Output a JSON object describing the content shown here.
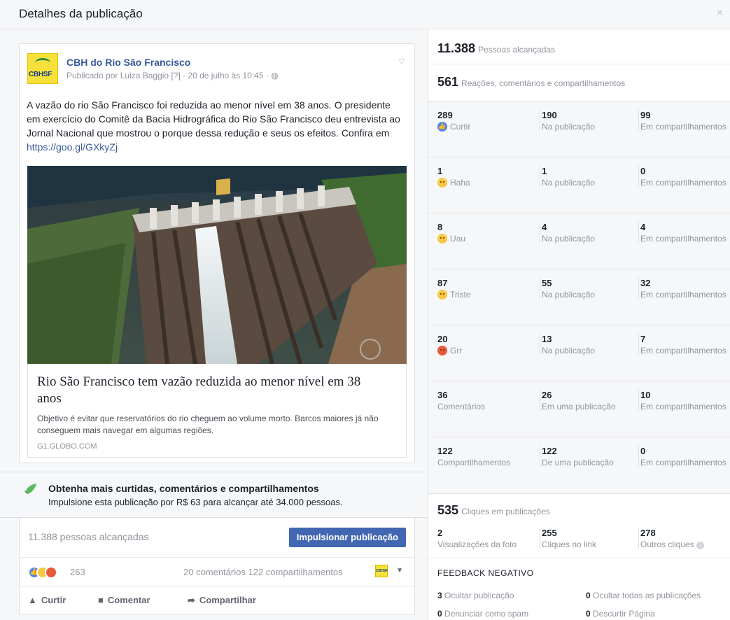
{
  "modal": {
    "title": "Detalhes da publicação",
    "close": "×"
  },
  "post": {
    "page_name": "CBH do Rio São Francisco",
    "logo_text": "CBHSF",
    "meta": "Publicado por Luiza Baggio [?] · 20 de julho às 10:45 · ◍",
    "text": "A vazão do rio São Francisco foi reduzida ao menor nível em 38 anos. O presidente em exercício do Comitê da Bacia Hidrográfica do Rio São Francisco deu entrevista ao Jornal Nacional que mostrou o porque dessa redução e seus os efeitos. Confira em ",
    "link_text": "https://goo.gl/GXkyZj",
    "link_title": "Rio São Francisco tem vazão reduzida ao menor nível em 38 anos",
    "link_desc": "Objetivo é evitar que reservatórios do rio cheguem ao volume morto. Barcos maiores já não conseguem mais navegar em algumas regiões.",
    "link_domain": "G1.GLOBO.COM"
  },
  "boost": {
    "title": "Obtenha mais curtidas, comentários e compartilhamentos",
    "subtitle": "Impulsione esta publicação por R$ 63 para alcançar até 34.000 pessoas.",
    "reach": "11.388 pessoas alcançadas",
    "button": "Impulsionar publicação"
  },
  "reactions_bar": {
    "count": "263",
    "comments_shares": "20 comentários  122 compartilhamentos"
  },
  "actions": {
    "like": "Curtir",
    "comment": "Comentar",
    "share": "Compartilhar"
  },
  "insights": {
    "reach_num": "11.388",
    "reach_lbl": "Pessoas alcançadas",
    "engage_num": "561",
    "engage_lbl": "Reações, comentários e compartilhamentos",
    "rows": [
      {
        "total": "289",
        "label": "Curtir",
        "post": "190",
        "post_lbl": "Na publicação",
        "shares": "99",
        "shares_lbl": "Em compartilhamentos"
      },
      {
        "total": "1",
        "label": "Haha",
        "post": "1",
        "post_lbl": "Na publicação",
        "shares": "0",
        "shares_lbl": "Em compartilhamentos"
      },
      {
        "total": "8",
        "label": "Uau",
        "post": "4",
        "post_lbl": "Na publicação",
        "shares": "4",
        "shares_lbl": "Em compartilhamentos"
      },
      {
        "total": "87",
        "label": "Triste",
        "post": "55",
        "post_lbl": "Na publicação",
        "shares": "32",
        "shares_lbl": "Em compartilhamentos"
      },
      {
        "total": "20",
        "label": "Grr",
        "post": "13",
        "post_lbl": "Na publicação",
        "shares": "7",
        "shares_lbl": "Em compartilhamentos"
      },
      {
        "total": "36",
        "label": "Comentários",
        "post": "26",
        "post_lbl": "Em uma publicação",
        "shares": "10",
        "shares_lbl": "Em compartilhamentos"
      },
      {
        "total": "122",
        "label": "Compartilhamentos",
        "post": "122",
        "post_lbl": "De uma publicação",
        "shares": "0",
        "shares_lbl": "Em compartilhamentos"
      }
    ],
    "clicks_num": "535",
    "clicks_lbl": "Cliques em publicações",
    "clicks": [
      {
        "num": "2",
        "lbl": "Visualizações da foto"
      },
      {
        "num": "255",
        "lbl": "Cliques no link"
      },
      {
        "num": "278",
        "lbl": "Outros cliques"
      }
    ],
    "neg_title": "FEEDBACK NEGATIVO",
    "negative": [
      {
        "num": "3",
        "lbl": "Ocultar publicação"
      },
      {
        "num": "0",
        "lbl": "Ocultar todas as publicações"
      },
      {
        "num": "0",
        "lbl": "Denunciar como spam"
      },
      {
        "num": "0",
        "lbl": "Descurtir Página"
      }
    ]
  },
  "colors": {
    "brand_blue": "#4267b2",
    "link": "#365899",
    "muted": "#90949c"
  }
}
